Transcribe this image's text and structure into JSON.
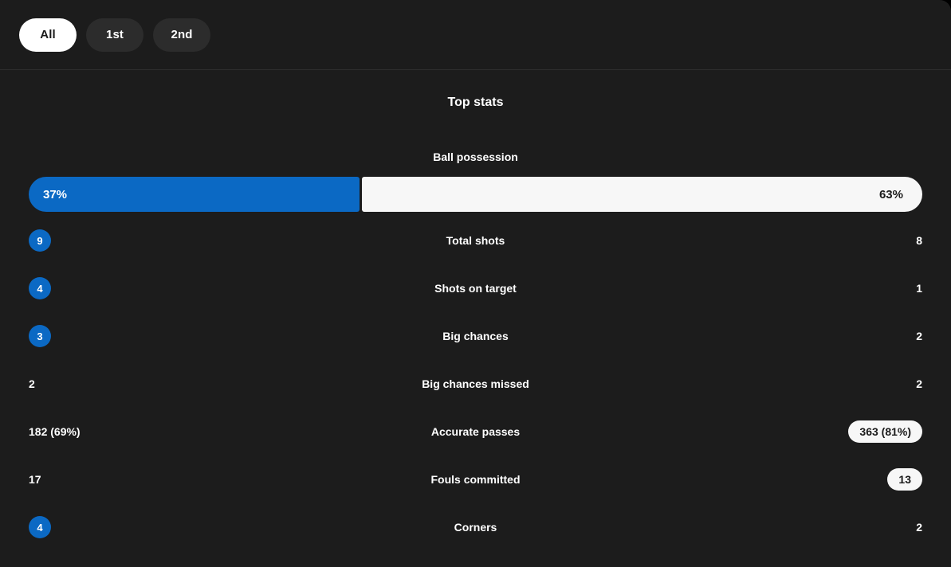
{
  "tabs": [
    {
      "label": "All",
      "active": true
    },
    {
      "label": "1st",
      "active": false
    },
    {
      "label": "2nd",
      "active": false
    }
  ],
  "section": {
    "title": "Top stats"
  },
  "possession": {
    "label": "Ball possession",
    "home_text": "37%",
    "away_text": "63%",
    "home_value": 37,
    "away_value": 63
  },
  "colors": {
    "accent_blue": "#0b69c4",
    "pill_white": "#f7f7f7",
    "background": "#1c1c1c",
    "tab_inactive": "#2c2c2c"
  },
  "stats": [
    {
      "label": "Total shots",
      "home": "9",
      "away": "8",
      "home_style": "circle",
      "away_style": "plain"
    },
    {
      "label": "Shots on target",
      "home": "4",
      "away": "1",
      "home_style": "circle",
      "away_style": "plain"
    },
    {
      "label": "Big chances",
      "home": "3",
      "away": "2",
      "home_style": "circle",
      "away_style": "plain"
    },
    {
      "label": "Big chances missed",
      "home": "2",
      "away": "2",
      "home_style": "plain",
      "away_style": "plain"
    },
    {
      "label": "Accurate passes",
      "home": "182 (69%)",
      "away": "363 (81%)",
      "home_style": "plain",
      "away_style": "pill"
    },
    {
      "label": "Fouls committed",
      "home": "17",
      "away": "13",
      "home_style": "plain",
      "away_style": "pill"
    },
    {
      "label": "Corners",
      "home": "4",
      "away": "2",
      "home_style": "circle",
      "away_style": "plain"
    }
  ]
}
